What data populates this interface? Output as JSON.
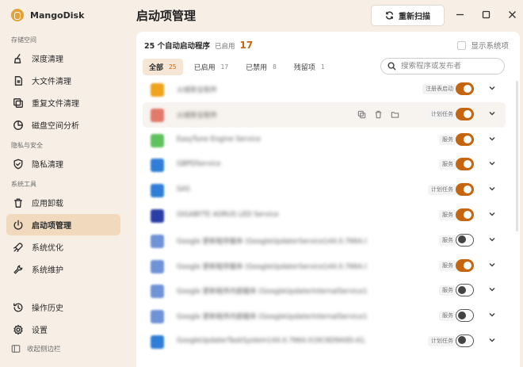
{
  "app": {
    "name": "MangoDisk"
  },
  "sidebar": {
    "sections": [
      {
        "title": "存储空间"
      },
      {
        "title": "隐私与安全"
      },
      {
        "title": "系统工具"
      }
    ],
    "items": [
      {
        "label": "深度清理",
        "icon": "broom-icon"
      },
      {
        "label": "大文件清理",
        "icon": "file-icon"
      },
      {
        "label": "重复文件清理",
        "icon": "copy-icon"
      },
      {
        "label": "磁盘空间分析",
        "icon": "pie-chart-icon"
      },
      {
        "label": "隐私清理",
        "icon": "shield-icon"
      },
      {
        "label": "应用卸载",
        "icon": "trash-icon"
      },
      {
        "label": "启动项管理",
        "icon": "power-icon",
        "active": true
      },
      {
        "label": "系统优化",
        "icon": "rocket-icon"
      },
      {
        "label": "系统维护",
        "icon": "wrench-icon"
      },
      {
        "label": "操作历史",
        "icon": "history-icon"
      },
      {
        "label": "设置",
        "icon": "gear-icon"
      }
    ],
    "collapse_label": "收起侧边栏"
  },
  "header": {
    "title": "启动项管理",
    "rescan_label": "重新扫描"
  },
  "summary": {
    "text": "25 个自动启动程序",
    "enabled_label": "已启用",
    "enabled_count": "17",
    "show_system_label": "显示系统项"
  },
  "tabs": [
    {
      "label": "全部",
      "count": "25",
      "active": true
    },
    {
      "label": "已启用",
      "count": "17"
    },
    {
      "label": "已禁用",
      "count": "8"
    },
    {
      "label": "残留项",
      "count": "1"
    }
  ],
  "search": {
    "placeholder": "搜索程序或发布者",
    "value": ""
  },
  "rows": [
    {
      "name": "火绒安全软件",
      "tag": "注册表启动",
      "enabled": true,
      "icon_color": "#f0a31c"
    },
    {
      "name": "火绒安全软件",
      "tag": "计划任务",
      "enabled": true,
      "icon_color": "#e27a6a"
    },
    {
      "name": "EasyTune Engine Service",
      "tag": "服务",
      "enabled": true,
      "icon_color": "#5ec25e"
    },
    {
      "name": "GBPDService",
      "tag": "服务",
      "enabled": true,
      "icon_color": "#2f7fd8"
    },
    {
      "name": "SAS",
      "tag": "计划任务",
      "enabled": true,
      "icon_color": "#2f7fd8"
    },
    {
      "name": "GIGABYTE AORUS LED Service",
      "tag": "服务",
      "enabled": true,
      "icon_color": "#2a3ea8"
    },
    {
      "name": "Google 更新程序服务 (GoogleUpdaterService144.0.7664.0)",
      "tag": "服务",
      "enabled": false,
      "icon_color": "#6f93d6"
    },
    {
      "name": "Google 更新程序服务 (GoogleUpdaterService144.0.7664.0)",
      "tag": "服务",
      "enabled": true,
      "icon_color": "#6f93d6"
    },
    {
      "name": "Google 更新程序内部服务 (GoogleUpdaterInternalService144.0)",
      "tag": "服务",
      "enabled": false,
      "icon_color": "#6f93d6"
    },
    {
      "name": "Google 更新程序内部服务 (GoogleUpdaterInternalService144.0)",
      "tag": "服务",
      "enabled": false,
      "icon_color": "#6f93d6"
    },
    {
      "name": "GoogleUpdaterTaskSystem144.0.7664.0{6C6D9A0D-A1...}",
      "tag": "计划任务",
      "enabled": false,
      "icon_color": "#2f7fd8"
    }
  ],
  "colors": {
    "accent": "#c5650f",
    "sidebar_bg": "#f7eee5",
    "active_bg": "#f1d9bd"
  }
}
